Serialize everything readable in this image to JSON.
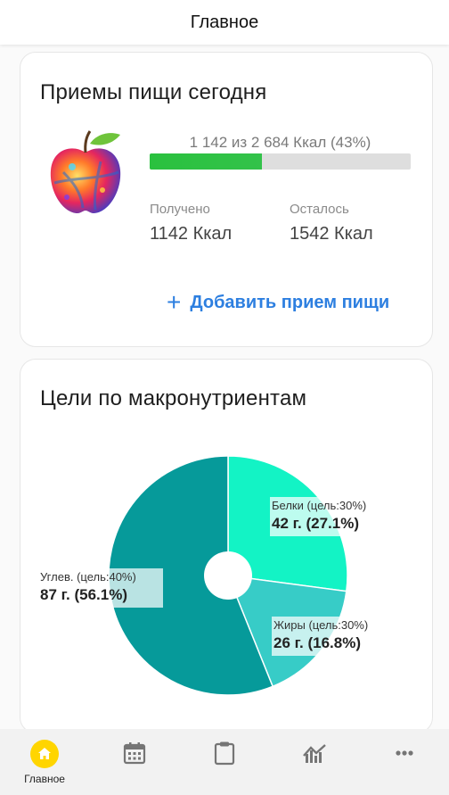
{
  "header": {
    "title": "Главное"
  },
  "meals_card": {
    "title": "Приемы пищи сегодня",
    "progress_text": "1 142 из 2 684 Ккал (43%)",
    "progress_fraction": 0.43,
    "received_label": "Получено",
    "received_value": "1142 Ккал",
    "remaining_label": "Осталось",
    "remaining_value": "1542 Ккал",
    "add_meal_label": "Добавить прием пищи",
    "accent_color": "#2d7fe0",
    "progress_color": "#2ac13e"
  },
  "macros_card": {
    "title": "Цели по макронутриентам",
    "chart_data": {
      "type": "pie",
      "style": "donut",
      "slices": [
        {
          "label": "Белки (цель:30%)",
          "value": "42 г. (27.1%)",
          "percent": 27.1,
          "color": "#13f3c5"
        },
        {
          "label": "Жиры (цель:30%)",
          "value": "26 г. (16.8%)",
          "percent": 16.8,
          "color": "#37ccc7"
        },
        {
          "label": "Углев. (цель:40%)",
          "value": "87 г. (56.1%)",
          "percent": 56.1,
          "color": "#069a9a"
        }
      ]
    }
  },
  "bottom_nav": {
    "items": [
      {
        "name": "home",
        "label": "Главное",
        "icon": "home-icon",
        "active": true
      },
      {
        "name": "calendar",
        "label": "",
        "icon": "calendar-icon",
        "active": false
      },
      {
        "name": "clipboard",
        "label": "",
        "icon": "clipboard-icon",
        "active": false
      },
      {
        "name": "progress",
        "label": "",
        "icon": "chart-icon",
        "active": false
      },
      {
        "name": "more",
        "label": "",
        "icon": "more-icon",
        "active": false
      }
    ],
    "active_color": "#ffd500"
  }
}
